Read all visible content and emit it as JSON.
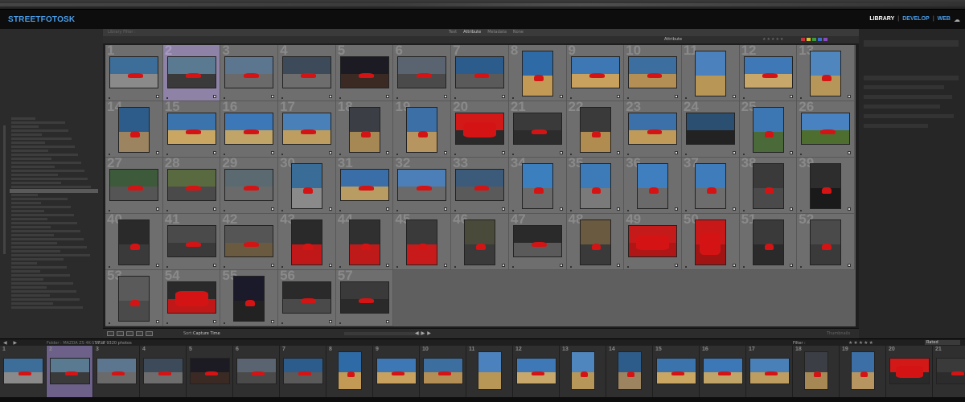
{
  "identity": {
    "brand": "STREETFOTOSK"
  },
  "modules": [
    {
      "label": "LIBRARY",
      "state": "active"
    },
    {
      "label": "DEVELOP",
      "state": "inactive"
    },
    {
      "label": "WEB",
      "state": "inactive"
    }
  ],
  "filter_bar": {
    "title": "Library Filter :",
    "tabs": [
      {
        "label": "Text",
        "on": false
      },
      {
        "label": "Attribute",
        "on": true
      },
      {
        "label": "Metadata",
        "on": false
      },
      {
        "label": "None",
        "on": false
      }
    ],
    "attribute_label": "Attribute",
    "stars": "★★★★★",
    "color_labels": [
      "#c8323a",
      "#d8c229",
      "#3b9b3b",
      "#3b6bd1",
      "#8a4ac0"
    ]
  },
  "toolbar": {
    "sort_label": "Sort:",
    "sort_value": "Capture Time",
    "thumbnails_label": "Thumbnails"
  },
  "filmstrip_header": {
    "folder": "Folder : MAZDA ZS 4K-STAGE",
    "count": "57 of 9320 photos",
    "filter_label": "Filter :",
    "stars": "★★★★★",
    "rated": "Rated"
  },
  "photos": [
    {
      "n": "1",
      "o": "land",
      "sky": "#3d6e9a",
      "gnd": "#8a8a8a",
      "car": "small"
    },
    {
      "n": "2",
      "o": "land",
      "sky": "#5a7a92",
      "gnd": "#3a3a3a",
      "car": "small",
      "sel": true
    },
    {
      "n": "3",
      "o": "land",
      "sky": "#5d7690",
      "gnd": "#6a6a6a",
      "car": "small"
    },
    {
      "n": "4",
      "o": "land",
      "sky": "#3c4a5a",
      "gnd": "#6d6d6d",
      "car": "small"
    },
    {
      "n": "5",
      "o": "land",
      "sky": "#1c1a22",
      "gnd": "#3b2a24",
      "car": "small"
    },
    {
      "n": "6",
      "o": "land",
      "sky": "#5a6370",
      "gnd": "#4a4a4a",
      "car": "small"
    },
    {
      "n": "7",
      "o": "land",
      "sky": "#2b5c8c",
      "gnd": "#5a5a5a",
      "car": "small"
    },
    {
      "n": "8",
      "o": "port",
      "sky": "#2e6aa6",
      "gnd": "#c29a55",
      "car": "small"
    },
    {
      "n": "9",
      "o": "land",
      "sky": "#3d78b4",
      "gnd": "#c7a15d",
      "car": "small"
    },
    {
      "n": "10",
      "o": "land",
      "sky": "#3c6e9f",
      "gnd": "#b38f55",
      "car": "small"
    },
    {
      "n": "11",
      "o": "port",
      "sky": "#4b82bd",
      "gnd": "#b89656",
      "car": "none"
    },
    {
      "n": "12",
      "o": "land",
      "sky": "#3e78b6",
      "gnd": "#c7a86a",
      "car": "small"
    },
    {
      "n": "13",
      "o": "port",
      "sky": "#4f86be",
      "gnd": "#b69659",
      "car": "small"
    },
    {
      "n": "14",
      "o": "port",
      "sky": "#2e5c8a",
      "gnd": "#9c8460",
      "car": "small"
    },
    {
      "n": "15",
      "o": "land",
      "sky": "#3b73ad",
      "gnd": "#c9a662",
      "car": "small"
    },
    {
      "n": "16",
      "o": "land",
      "sky": "#3c78b8",
      "gnd": "#c0a468",
      "car": "small"
    },
    {
      "n": "17",
      "o": "land",
      "sky": "#4a80b8",
      "gnd": "#bd9d60",
      "car": "small"
    },
    {
      "n": "18",
      "o": "port",
      "sky": "#3b3f45",
      "gnd": "#a68855",
      "car": "small"
    },
    {
      "n": "19",
      "o": "port",
      "sky": "#3b6fa6",
      "gnd": "#b69560",
      "car": "small"
    },
    {
      "n": "20",
      "o": "land",
      "sky": "#d31818",
      "gnd": "#2a2a2a",
      "car": "big"
    },
    {
      "n": "21",
      "o": "land",
      "sky": "#3a3a3a",
      "gnd": "#2c2c2c",
      "car": "small"
    },
    {
      "n": "22",
      "o": "port",
      "sky": "#3a3a3a",
      "gnd": "#b08c50",
      "car": "small"
    },
    {
      "n": "23",
      "o": "land",
      "sky": "#3b70a8",
      "gnd": "#c09a58",
      "car": "small"
    },
    {
      "n": "24",
      "o": "land",
      "sky": "#2b4f70",
      "gnd": "#222222",
      "car": "none"
    },
    {
      "n": "25",
      "o": "port",
      "sky": "#3c77b3",
      "gnd": "#4a6a3a",
      "car": "small"
    },
    {
      "n": "26",
      "o": "land",
      "sky": "#4882c0",
      "gnd": "#4e6e30",
      "car": "small"
    },
    {
      "n": "27",
      "o": "land",
      "sky": "#3d5a3a",
      "gnd": "#555555",
      "car": "small"
    },
    {
      "n": "28",
      "o": "land",
      "sky": "#5a6a40",
      "gnd": "#4a4a4a",
      "car": "small"
    },
    {
      "n": "29",
      "o": "land",
      "sky": "#5a6a70",
      "gnd": "#6a6a6a",
      "car": "small"
    },
    {
      "n": "30",
      "o": "port",
      "sky": "#3a6c98",
      "gnd": "#8a8a8a",
      "car": "small"
    },
    {
      "n": "31",
      "o": "land",
      "sky": "#3a6ea8",
      "gnd": "#b89c62",
      "car": "small"
    },
    {
      "n": "32",
      "o": "land",
      "sky": "#4c7fb8",
      "gnd": "#6a6a6a",
      "car": "small"
    },
    {
      "n": "33",
      "o": "land",
      "sky": "#3c5a7a",
      "gnd": "#5a5a5a",
      "car": "small"
    },
    {
      "n": "34",
      "o": "port",
      "sky": "#3c7fbf",
      "gnd": "#6a6a6a",
      "car": "small"
    },
    {
      "n": "35",
      "o": "port",
      "sky": "#3c7ab8",
      "gnd": "#7a7a7a",
      "car": "small"
    },
    {
      "n": "36",
      "o": "port",
      "sky": "#3f7fc0",
      "gnd": "#6a6a6a",
      "car": "small"
    },
    {
      "n": "37",
      "o": "port",
      "sky": "#3e7cbc",
      "gnd": "#6d6d6d",
      "car": "small"
    },
    {
      "n": "38",
      "o": "port",
      "sky": "#3a3a3a",
      "gnd": "#4a4a4a",
      "car": "small"
    },
    {
      "n": "39",
      "o": "port",
      "sky": "#2d2d2d",
      "gnd": "#1a1a1a",
      "car": "small"
    },
    {
      "n": "40",
      "o": "port",
      "sky": "#2a2a2a",
      "gnd": "#3a3a3a",
      "car": "small"
    },
    {
      "n": "41",
      "o": "land",
      "sky": "#4a4a4a",
      "gnd": "#3a3a3a",
      "car": "small"
    },
    {
      "n": "42",
      "o": "land",
      "sky": "#555555",
      "gnd": "#6a5a40",
      "car": "small"
    },
    {
      "n": "43",
      "o": "port",
      "sky": "#2a2a2a",
      "gnd": "#c01818",
      "car": "small"
    },
    {
      "n": "44",
      "o": "port",
      "sky": "#303030",
      "gnd": "#bf1a1a",
      "car": "small"
    },
    {
      "n": "45",
      "o": "port",
      "sky": "#3a3a3a",
      "gnd": "#c81a1a",
      "car": "small"
    },
    {
      "n": "46",
      "o": "port",
      "sky": "#4a4a3a",
      "gnd": "#3a3a3a",
      "car": "small"
    },
    {
      "n": "47",
      "o": "land",
      "sky": "#2a2a2a",
      "gnd": "#5a5a5a",
      "car": "small"
    },
    {
      "n": "48",
      "o": "port",
      "sky": "#6a5a40",
      "gnd": "#3a3a3a",
      "car": "small"
    },
    {
      "n": "49",
      "o": "land",
      "sky": "#c41a1a",
      "gnd": "#b01616",
      "car": "big"
    },
    {
      "n": "50",
      "o": "port",
      "sky": "#c81818",
      "gnd": "#a01414",
      "car": "big"
    },
    {
      "n": "51",
      "o": "port",
      "sky": "#3a3a3a",
      "gnd": "#2a2a2a",
      "car": "small"
    },
    {
      "n": "52",
      "o": "port",
      "sky": "#4a4a4a",
      "gnd": "#3a3a3a",
      "car": "small"
    },
    {
      "n": "53",
      "o": "port",
      "sky": "#5a5a5a",
      "gnd": "#4a4a4a",
      "car": "small"
    },
    {
      "n": "54",
      "o": "land",
      "sky": "#2a2a2a",
      "gnd": "#c01818",
      "car": "big"
    },
    {
      "n": "55",
      "o": "port",
      "sky": "#1a1a2a",
      "gnd": "#222222",
      "car": "small"
    },
    {
      "n": "56",
      "o": "land",
      "sky": "#2a2a2a",
      "gnd": "#4a4a4a",
      "car": "small"
    },
    {
      "n": "57",
      "o": "land",
      "sky": "#3a3a3a",
      "gnd": "#2a2a2a",
      "car": "small"
    }
  ],
  "filmstrip": [
    {
      "n": "1",
      "o": "land",
      "sky": "#3d6e9a",
      "gnd": "#8a8a8a",
      "car": "small"
    },
    {
      "n": "2",
      "o": "land",
      "sky": "#5a7a92",
      "gnd": "#3a3a3a",
      "car": "small",
      "sel": true
    },
    {
      "n": "3",
      "o": "land",
      "sky": "#5d7690",
      "gnd": "#6a6a6a",
      "car": "small"
    },
    {
      "n": "4",
      "o": "land",
      "sky": "#3c4a5a",
      "gnd": "#6d6d6d",
      "car": "small"
    },
    {
      "n": "5",
      "o": "land",
      "sky": "#1c1a22",
      "gnd": "#3b2a24",
      "car": "small"
    },
    {
      "n": "6",
      "o": "land",
      "sky": "#5a6370",
      "gnd": "#4a4a4a",
      "car": "small"
    },
    {
      "n": "7",
      "o": "land",
      "sky": "#2b5c8c",
      "gnd": "#5a5a5a",
      "car": "small"
    },
    {
      "n": "8",
      "o": "port",
      "sky": "#2e6aa6",
      "gnd": "#c29a55",
      "car": "small"
    },
    {
      "n": "9",
      "o": "land",
      "sky": "#3d78b4",
      "gnd": "#c7a15d",
      "car": "small"
    },
    {
      "n": "10",
      "o": "land",
      "sky": "#3c6e9f",
      "gnd": "#b38f55",
      "car": "small"
    },
    {
      "n": "11",
      "o": "port",
      "sky": "#4b82bd",
      "gnd": "#b89656",
      "car": "none"
    },
    {
      "n": "12",
      "o": "land",
      "sky": "#3e78b6",
      "gnd": "#c7a86a",
      "car": "small"
    },
    {
      "n": "13",
      "o": "port",
      "sky": "#4f86be",
      "gnd": "#b69659",
      "car": "small"
    },
    {
      "n": "14",
      "o": "port",
      "sky": "#2e5c8a",
      "gnd": "#9c8460",
      "car": "small"
    },
    {
      "n": "15",
      "o": "land",
      "sky": "#3b73ad",
      "gnd": "#c9a662",
      "car": "small"
    },
    {
      "n": "16",
      "o": "land",
      "sky": "#3c78b8",
      "gnd": "#c0a468",
      "car": "small"
    },
    {
      "n": "17",
      "o": "land",
      "sky": "#4a80b8",
      "gnd": "#bd9d60",
      "car": "small"
    },
    {
      "n": "18",
      "o": "port",
      "sky": "#3b3f45",
      "gnd": "#a68855",
      "car": "small"
    },
    {
      "n": "19",
      "o": "port",
      "sky": "#3b6fa6",
      "gnd": "#b69560",
      "car": "small"
    },
    {
      "n": "20",
      "o": "land",
      "sky": "#d31818",
      "gnd": "#2a2a2a",
      "car": "big"
    },
    {
      "n": "21",
      "o": "land",
      "sky": "#3a3a3a",
      "gnd": "#2c2c2c",
      "car": "small"
    }
  ]
}
